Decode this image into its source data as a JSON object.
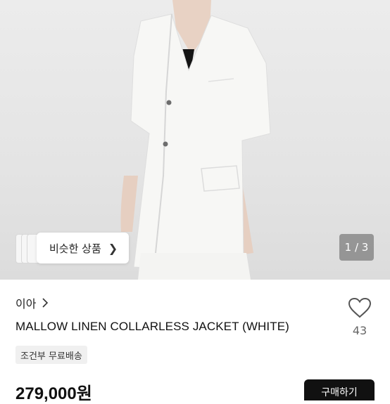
{
  "gallery": {
    "counter": "1 / 3",
    "similar_label": "비슷한 상품"
  },
  "product": {
    "seller": "이아",
    "title": "MALLOW LINEN COLLARLESS JACKET (WHITE)",
    "likes": "43",
    "shipping_badge": "조건부 무료배송",
    "price": "279,000원"
  },
  "actions": {
    "primary_label": "구매하기"
  },
  "icons": {
    "chevron": "chevron-right-icon",
    "heart": "heart-outline-icon"
  },
  "colors": {
    "background": "#ffffff",
    "badge_bg": "#f0f0f0",
    "button_bg": "#111111",
    "counter_bg": "#5a5a5a"
  }
}
